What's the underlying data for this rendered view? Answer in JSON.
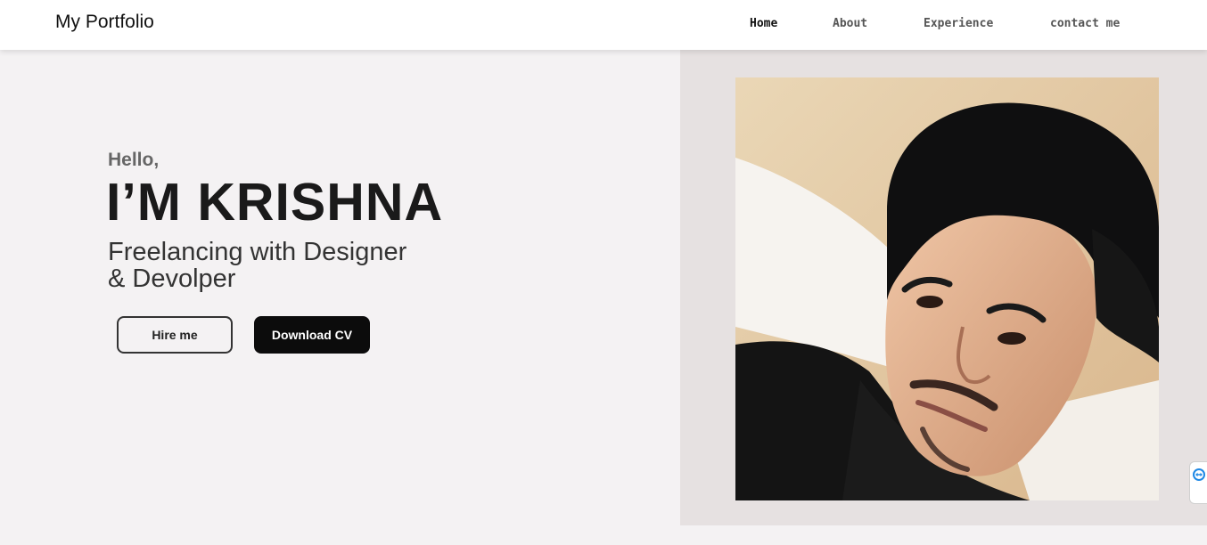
{
  "nav": {
    "brand": "My Portfolio",
    "links": [
      {
        "label": "Home",
        "active": true
      },
      {
        "label": "About",
        "active": false
      },
      {
        "label": "Experience",
        "active": false
      },
      {
        "label": "contact me",
        "active": false
      }
    ]
  },
  "hero": {
    "greeting": "Hello,",
    "name": "I’M KRISHNA",
    "tagline_line1": "Freelancing with Designer",
    "tagline_line2": "& Devolper",
    "hire_button": "Hire me",
    "download_button": "Download CV"
  },
  "photo": {
    "icon": "profile-photo"
  },
  "side_widget": {
    "icon": "remote-support-icon"
  },
  "colors": {
    "nav_bg": "#ffffff",
    "page_bg": "#f4f2f3",
    "photo_panel_bg": "#e6e1e1",
    "primary_button": "#0c0c0c",
    "widget_accent": "#1e88e5"
  }
}
